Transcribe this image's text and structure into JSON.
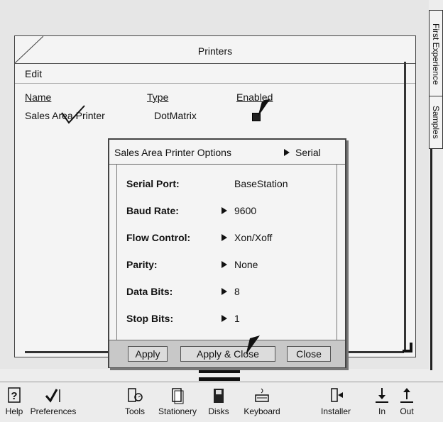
{
  "side_tabs": {
    "first_experience": "First Experience",
    "samples": "Samples"
  },
  "printers_window": {
    "title": "Printers",
    "menu": {
      "edit": "Edit"
    },
    "columns": {
      "name": "Name",
      "type": "Type",
      "enabled": "Enabled"
    },
    "row": {
      "name": "Sales Area Printer",
      "type": "DotMatrix",
      "enabled": true
    }
  },
  "options_dialog": {
    "title": "Sales Area Printer Options",
    "crumb": "Serial",
    "rows": [
      {
        "label": "Serial Port:",
        "value": "BaseStation",
        "has_arrow": false
      },
      {
        "label": "Baud Rate:",
        "value": "9600",
        "has_arrow": true
      },
      {
        "label": "Flow Control:",
        "value": "Xon/Xoff",
        "has_arrow": true
      },
      {
        "label": "Parity:",
        "value": "None",
        "has_arrow": true
      },
      {
        "label": "Data Bits:",
        "value": "8",
        "has_arrow": true
      },
      {
        "label": "Stop Bits:",
        "value": "1",
        "has_arrow": true
      }
    ],
    "buttons": {
      "apply": "Apply",
      "apply_close": "Apply & Close",
      "close": "Close"
    }
  },
  "launcher": {
    "items": [
      {
        "label": "Help",
        "icon": "help-icon"
      },
      {
        "label": "Preferences",
        "icon": "checkmark-icon"
      },
      {
        "label": "Tools",
        "icon": "tools-icon"
      },
      {
        "label": "Stationery",
        "icon": "stationery-icon"
      },
      {
        "label": "Disks",
        "icon": "disk-icon"
      },
      {
        "label": "Keyboard",
        "icon": "keyboard-icon"
      },
      {
        "label": "Installer",
        "icon": "installer-icon"
      },
      {
        "label": "In",
        "icon": "in-tray-icon"
      },
      {
        "label": "Out",
        "icon": "out-tray-icon"
      }
    ]
  }
}
